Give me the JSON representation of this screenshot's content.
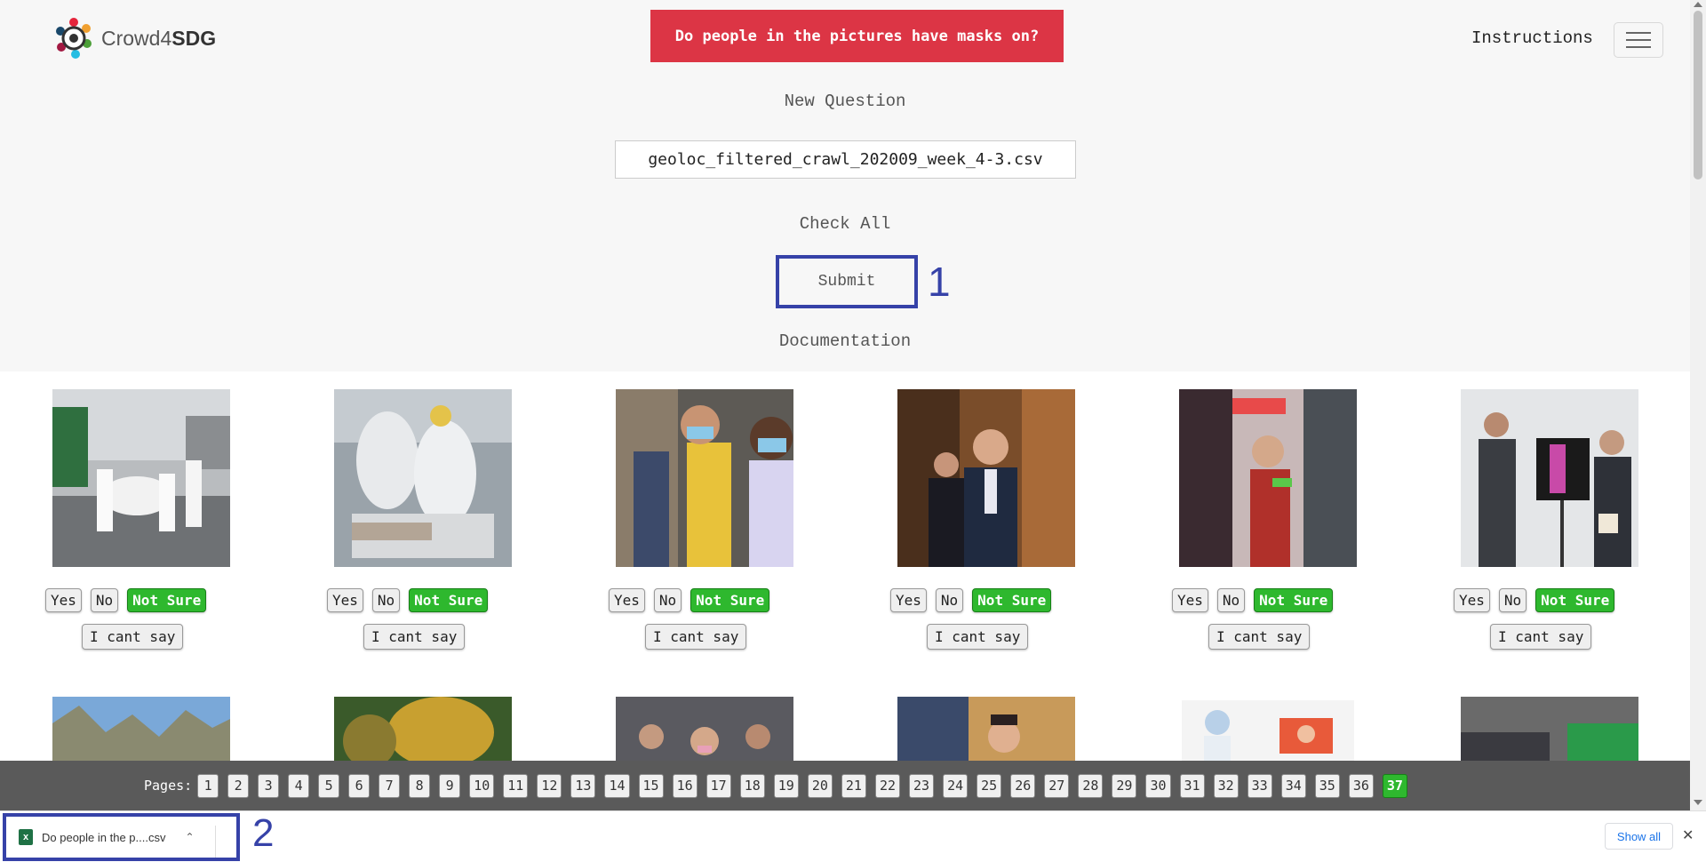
{
  "header": {
    "logo_text_regular": "Crowd4",
    "logo_text_bold": "SDG",
    "question_banner": "Do people in the pictures have masks on?",
    "instructions_label": "Instructions",
    "menu_icon": "hamburger-icon"
  },
  "main": {
    "new_question_label": "New Question",
    "file_name": "geoloc_filtered_crawl_202009_week_4-3.csv",
    "check_all_label": "Check All",
    "submit_label": "Submit",
    "documentation_label": "Documentation",
    "annotation_1": "1",
    "annotation_2": "2"
  },
  "cards": [
    {
      "yes": "Yes",
      "no": "No",
      "not_sure": "Not Sure",
      "cant_say": "I cant say",
      "selected": "Not Sure"
    },
    {
      "yes": "Yes",
      "no": "No",
      "not_sure": "Not Sure",
      "cant_say": "I cant say",
      "selected": "Not Sure"
    },
    {
      "yes": "Yes",
      "no": "No",
      "not_sure": "Not Sure",
      "cant_say": "I cant say",
      "selected": "Not Sure"
    },
    {
      "yes": "Yes",
      "no": "No",
      "not_sure": "Not Sure",
      "cant_say": "I cant say",
      "selected": "Not Sure"
    },
    {
      "yes": "Yes",
      "no": "No",
      "not_sure": "Not Sure",
      "cant_say": "I cant say",
      "selected": "Not Sure"
    },
    {
      "yes": "Yes",
      "no": "No",
      "not_sure": "Not Sure",
      "cant_say": "I cant say",
      "selected": "Not Sure"
    }
  ],
  "pagination": {
    "label": "Pages:",
    "pages": [
      "1",
      "2",
      "3",
      "4",
      "5",
      "6",
      "7",
      "8",
      "9",
      "10",
      "11",
      "12",
      "13",
      "14",
      "15",
      "16",
      "17",
      "18",
      "19",
      "20",
      "21",
      "22",
      "23",
      "24",
      "25",
      "26",
      "27",
      "28",
      "29",
      "30",
      "31",
      "32",
      "33",
      "34",
      "35",
      "36",
      "37"
    ],
    "current": "37"
  },
  "download_bar": {
    "file_label": "Do people in the p....csv",
    "file_icon": "excel-file-icon",
    "file_icon_letter": "x",
    "show_all_label": "Show all"
  },
  "colors": {
    "banner": "#dc3545",
    "selected": "#2eb82e",
    "annotation": "#3642a8"
  }
}
